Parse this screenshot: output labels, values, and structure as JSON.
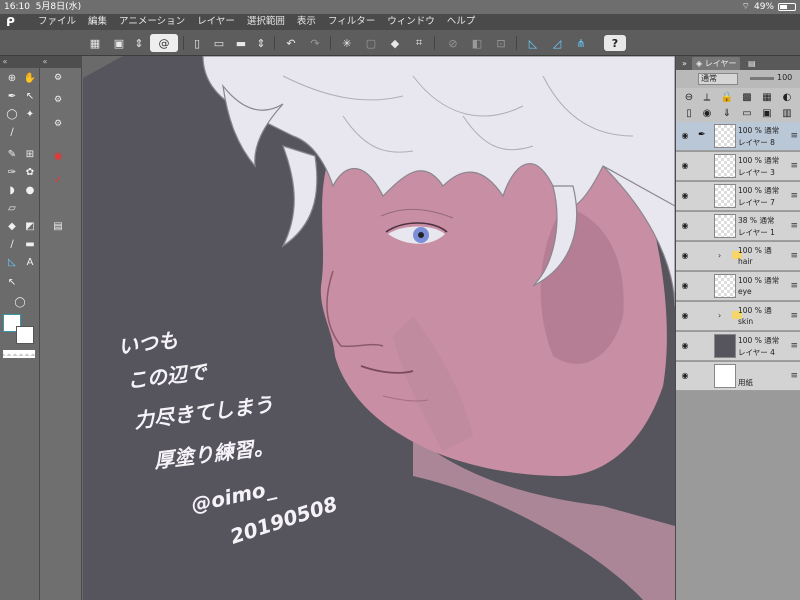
{
  "status": {
    "time": "16:10",
    "date": "5月8日(水)",
    "battery": "49%",
    "battery_level": 0.49
  },
  "menu": {
    "items": [
      "ファイル",
      "編集",
      "アニメーション",
      "レイヤー",
      "選択範囲",
      "表示",
      "フィルター",
      "ウィンドウ",
      "ヘルプ"
    ]
  },
  "toolbar": {
    "help_label": "?"
  },
  "layer_panel": {
    "tab_label": "レイヤー",
    "blend_mode": "通常",
    "opacity": "100",
    "layers": [
      {
        "line1": "100 % 通常",
        "line2": "レイヤー 8",
        "type": "raster",
        "selected": true
      },
      {
        "line1": "100 % 通常",
        "line2": "レイヤー 3",
        "type": "raster",
        "selected": false
      },
      {
        "line1": "100 % 通常",
        "line2": "レイヤー 7",
        "type": "raster",
        "selected": false
      },
      {
        "line1": "38 % 通常",
        "line2": "レイヤー 1",
        "type": "raster",
        "selected": false
      },
      {
        "line1": "100 % 通",
        "line2": "hair",
        "type": "folder",
        "selected": false
      },
      {
        "line1": "100 % 通常",
        "line2": "eye",
        "type": "raster",
        "selected": false
      },
      {
        "line1": "100 % 通",
        "line2": "skin",
        "type": "folder",
        "selected": false
      },
      {
        "line1": "100 % 通常",
        "line2": "レイヤー 4",
        "type": "fill",
        "selected": false
      },
      {
        "line1": "",
        "line2": "用紙",
        "type": "paper",
        "selected": false
      }
    ]
  },
  "canvas": {
    "handwriting": [
      "いつも",
      "この辺で",
      "力尽きてしまう",
      "厚塗り練習。",
      "@oimo_",
      "20190508"
    ],
    "background_color": "#56545c",
    "skin_color": "#c88ea3",
    "hair_color": "#e6e4ee"
  },
  "colors": {
    "fg": "#ffffff",
    "bg": "#ffffff"
  }
}
